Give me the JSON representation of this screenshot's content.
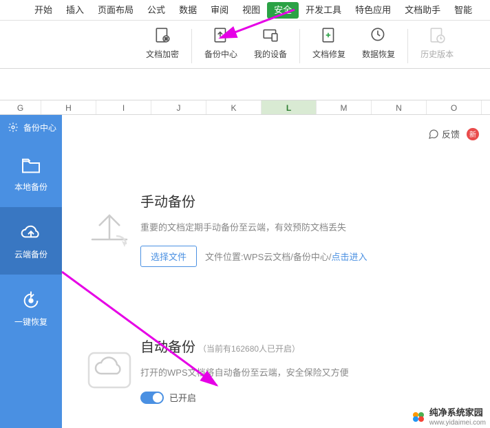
{
  "ribbonTabs": {
    "start": "开始",
    "insert": "插入",
    "layout": "页面布局",
    "formula": "公式",
    "data": "数据",
    "review": "审阅",
    "view": "视图",
    "security": "安全",
    "devtools": "开发工具",
    "special": "特色应用",
    "dochelper": "文档助手",
    "smart": "智能"
  },
  "tools": {
    "encrypt": "文档加密",
    "backupcenter": "备份中心",
    "mydevice": "我的设备",
    "docrepair": "文档修复",
    "datarecover": "数据恢复",
    "history": "历史版本"
  },
  "columns": [
    "G",
    "H",
    "I",
    "J",
    "K",
    "L",
    "M",
    "N",
    "O"
  ],
  "selectedColumn": "L",
  "sidebar": {
    "title": "备份中心",
    "local": "本地备份",
    "cloud": "云端备份",
    "restore": "一键恢复"
  },
  "feedback": "反馈",
  "badge": "新",
  "manual": {
    "title": "手动备份",
    "desc": "重要的文档定期手动备份至云端，有效预防文档丢失",
    "chooseBtn": "选择文件",
    "locationLabel": "文件位置:WPS云文档/备份中心/",
    "enterLink": "点击进入"
  },
  "auto": {
    "title": "自动备份",
    "count": "（当前有162680人已开启）",
    "desc": "打开的WPS文档将自动备份至云端，安全保险又方便",
    "enabled": "已开启"
  },
  "watermark": {
    "l1": "纯净系统家园",
    "l2": "www.yidaimei.com"
  }
}
